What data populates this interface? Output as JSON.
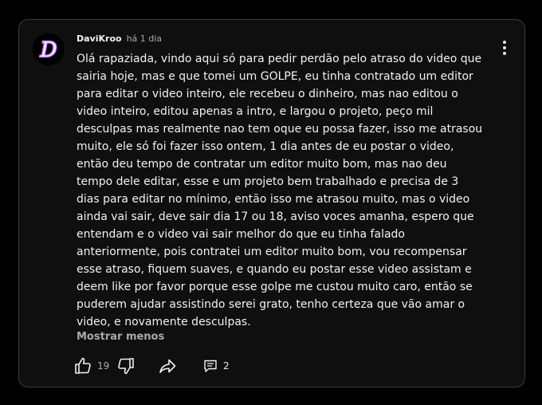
{
  "comment": {
    "author": "DaviKroo",
    "time": "há 1 dia",
    "text": "Olá rapaziada, vindo aqui só para pedir perdão pelo atraso do video que sairia hoje, mas e que tomei um GOLPE, eu tinha contratado um editor para editar o video inteiro, ele recebeu o dinheiro, mas nao editou o video inteiro, editou apenas a intro, e largou o projeto, peço mil desculpas mas realmente nao tem oque eu possa fazer, isso me atrasou muito, ele só foi fazer isso ontem, 1 dia antes de eu postar o video, então deu tempo de contratar um editor muito bom, mas nao deu tempo dele editar, esse e um projeto bem trabalhado e precisa de 3 dias para editar no mínimo, então isso me atrasou muito, mas o video ainda vai sair, deve sair dia 17 ou 18, aviso voces amanha, espero que entendam e o video vai sair melhor do que eu tinha falado anteriormente, pois contratei um editor muito bom, vou recompensar esse atraso, fiquem suaves,  e quando eu postar esse video assistam e deem like por favor porque esse golpe me custou muito caro, então se puderem ajudar assistindo serei grato, tenho certeza que vão amar o video, e novamente desculpas.",
    "show_less_label": "Mostrar menos",
    "like_count": "19",
    "reply_count": "2",
    "avatar_letter": "D"
  },
  "icons": {
    "avatar": "letter-d-neon-logo",
    "more": "vertical-ellipsis-icon",
    "like": "thumbs-up-icon",
    "dislike": "thumbs-down-icon",
    "share": "share-arrow-icon",
    "replies": "comment-bubble-icon"
  },
  "colors": {
    "card_background": "#0f0f0f",
    "card_border": "#3a3a3a",
    "text_primary": "#f1f1f1",
    "text_secondary": "#aaaaaa",
    "avatar_accent": "#b56cff"
  }
}
